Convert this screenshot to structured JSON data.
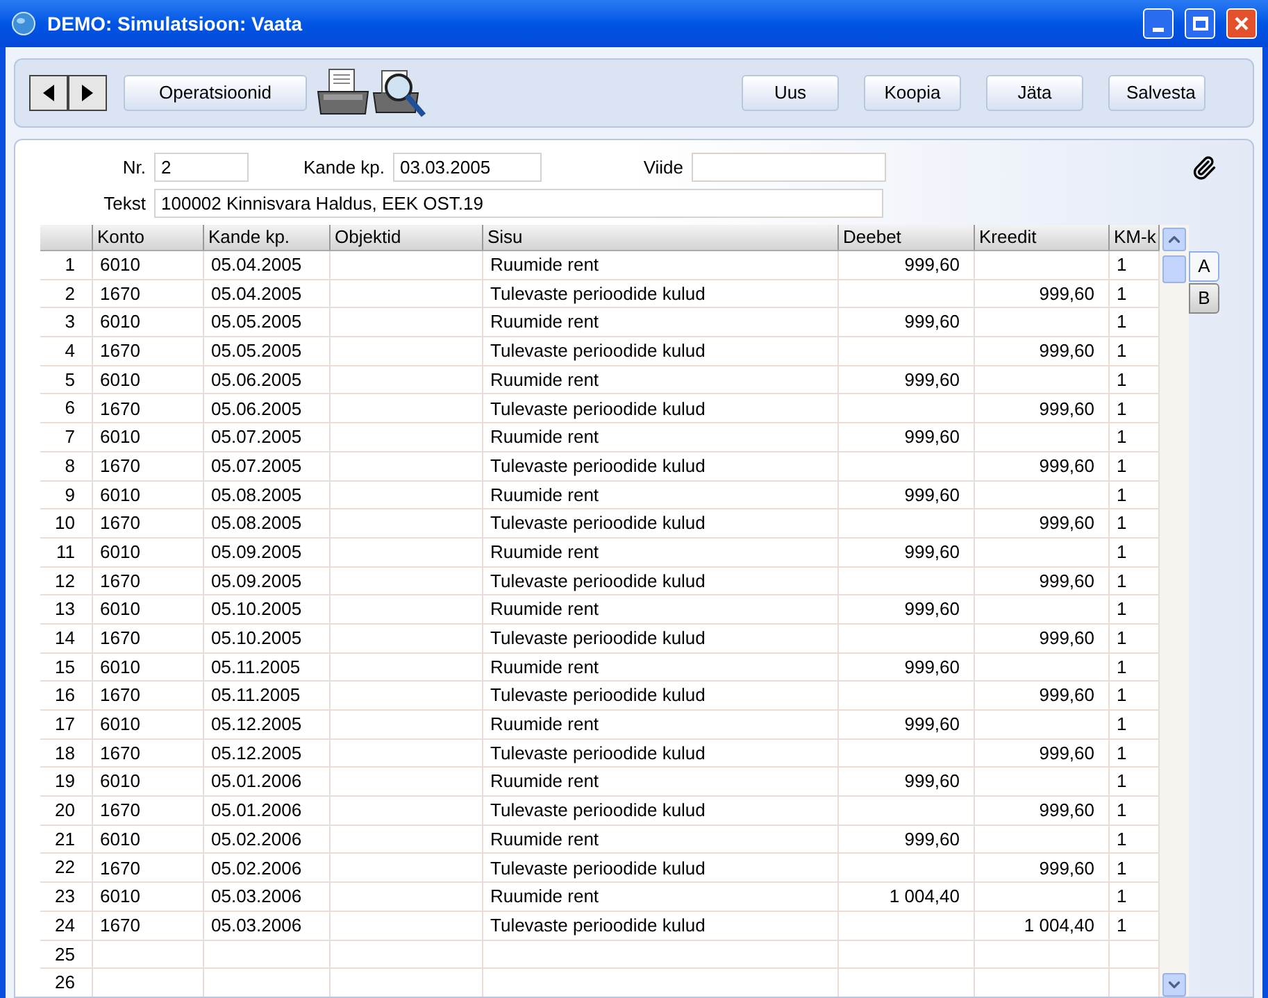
{
  "window": {
    "title": "DEMO: Simulatsioon: Vaata"
  },
  "toolbar": {
    "operations_button": "Operatsioonid",
    "buttons": [
      "Uus",
      "Koopia",
      "Jäta",
      "Salvesta"
    ]
  },
  "header": {
    "nr_label": "Nr.",
    "nr": "2",
    "date_label": "Kande kp.",
    "date": "03.03.2005",
    "ref_label": "Viide",
    "text_label": "Tekst",
    "text": "100002 Kinnisvara Haldus, EEK  OST.19"
  },
  "table": {
    "columns": [
      "Konto",
      "Kande kp.",
      "Objektid",
      "Sisu",
      "Deebet",
      "Kreedit",
      "KM-k"
    ],
    "rows": [
      {
        "nr": "1",
        "konto": "6010",
        "date": "05.04.2005",
        "sisu": "Ruumide rent",
        "deebet": "999,60",
        "kmk": "1"
      },
      {
        "nr": "2",
        "konto": "1670",
        "date": "05.04.2005",
        "sisu": "Tulevaste perioodide kulud",
        "kreedit": "999,60",
        "kmk": "1"
      },
      {
        "nr": "3",
        "konto": "6010",
        "date": "05.05.2005",
        "sisu": "Ruumide rent",
        "deebet": "999,60",
        "kmk": "1"
      },
      {
        "nr": "4",
        "konto": "1670",
        "date": "05.05.2005",
        "sisu": "Tulevaste perioodide kulud",
        "kreedit": "999,60",
        "kmk": "1"
      },
      {
        "nr": "5",
        "konto": "6010",
        "date": "05.06.2005",
        "sisu": "Ruumide rent",
        "deebet": "999,60",
        "kmk": "1"
      },
      {
        "nr": "6",
        "konto": "1670",
        "date": "05.06.2005",
        "sisu": "Tulevaste perioodide kulud",
        "kreedit": "999,60",
        "kmk": "1"
      },
      {
        "nr": "7",
        "konto": "6010",
        "date": "05.07.2005",
        "sisu": "Ruumide rent",
        "deebet": "999,60",
        "kmk": "1"
      },
      {
        "nr": "8",
        "konto": "1670",
        "date": "05.07.2005",
        "sisu": "Tulevaste perioodide kulud",
        "kreedit": "999,60",
        "kmk": "1"
      },
      {
        "nr": "9",
        "konto": "6010",
        "date": "05.08.2005",
        "sisu": "Ruumide rent",
        "deebet": "999,60",
        "kmk": "1"
      },
      {
        "nr": "10",
        "konto": "1670",
        "date": "05.08.2005",
        "sisu": "Tulevaste perioodide kulud",
        "kreedit": "999,60",
        "kmk": "1"
      },
      {
        "nr": "11",
        "konto": "6010",
        "date": "05.09.2005",
        "sisu": "Ruumide rent",
        "deebet": "999,60",
        "kmk": "1"
      },
      {
        "nr": "12",
        "konto": "1670",
        "date": "05.09.2005",
        "sisu": "Tulevaste perioodide kulud",
        "kreedit": "999,60",
        "kmk": "1"
      },
      {
        "nr": "13",
        "konto": "6010",
        "date": "05.10.2005",
        "sisu": "Ruumide rent",
        "deebet": "999,60",
        "kmk": "1"
      },
      {
        "nr": "14",
        "konto": "1670",
        "date": "05.10.2005",
        "sisu": "Tulevaste perioodide kulud",
        "kreedit": "999,60",
        "kmk": "1"
      },
      {
        "nr": "15",
        "konto": "6010",
        "date": "05.11.2005",
        "sisu": "Ruumide rent",
        "deebet": "999,60",
        "kmk": "1"
      },
      {
        "nr": "16",
        "konto": "1670",
        "date": "05.11.2005",
        "sisu": "Tulevaste perioodide kulud",
        "kreedit": "999,60",
        "kmk": "1"
      },
      {
        "nr": "17",
        "konto": "6010",
        "date": "05.12.2005",
        "sisu": "Ruumide rent",
        "deebet": "999,60",
        "kmk": "1"
      },
      {
        "nr": "18",
        "konto": "1670",
        "date": "05.12.2005",
        "sisu": "Tulevaste perioodide kulud",
        "kreedit": "999,60",
        "kmk": "1"
      },
      {
        "nr": "19",
        "konto": "6010",
        "date": "05.01.2006",
        "sisu": "Ruumide rent",
        "deebet": "999,60",
        "kmk": "1"
      },
      {
        "nr": "20",
        "konto": "1670",
        "date": "05.01.2006",
        "sisu": "Tulevaste perioodide kulud",
        "kreedit": "999,60",
        "kmk": "1"
      },
      {
        "nr": "21",
        "konto": "6010",
        "date": "05.02.2006",
        "sisu": "Ruumide rent",
        "deebet": "999,60",
        "kmk": "1"
      },
      {
        "nr": "22",
        "konto": "1670",
        "date": "05.02.2006",
        "sisu": "Tulevaste perioodide kulud",
        "kreedit": "999,60",
        "kmk": "1"
      },
      {
        "nr": "23",
        "konto": "6010",
        "date": "05.03.2006",
        "sisu": "Ruumide rent",
        "deebet": "1 004,40",
        "kmk": "1"
      },
      {
        "nr": "24",
        "konto": "1670",
        "date": "05.03.2006",
        "sisu": "Tulevaste perioodide kulud",
        "kreedit": "1 004,40",
        "kmk": "1"
      },
      {
        "nr": "25"
      },
      {
        "nr": "26"
      }
    ]
  },
  "side_tabs": [
    {
      "label": "A",
      "selected": true
    },
    {
      "label": "B",
      "selected": false
    }
  ]
}
